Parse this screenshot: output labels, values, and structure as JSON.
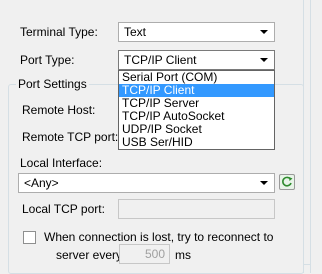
{
  "form": {
    "terminal_type_label": "Terminal Type:",
    "terminal_type_value": "Text",
    "port_type_label": "Port Type:",
    "port_type_value": "TCP/IP Client"
  },
  "port_type_options": [
    {
      "label": "Serial Port (COM)",
      "selected": false
    },
    {
      "label": "TCP/IP Client",
      "selected": true
    },
    {
      "label": "TCP/IP Server",
      "selected": false
    },
    {
      "label": "TCP/IP AutoSocket",
      "selected": false
    },
    {
      "label": "UDP/IP Socket",
      "selected": false
    },
    {
      "label": "USB Ser/HID",
      "selected": false
    }
  ],
  "port_settings": {
    "title": "Port Settings",
    "remote_host_label": "Remote Host:",
    "remote_tcp_port_label": "Remote TCP port:",
    "local_interface_label": "Local Interface:",
    "local_interface_value": "<Any>",
    "local_tcp_port_label": "Local TCP port:",
    "reconnect_label_line1": "When connection is lost, try to reconnect to",
    "reconnect_label_line2_prefix": "server every",
    "reconnect_interval_value": "500",
    "reconnect_interval_unit": "ms"
  },
  "colors": {
    "selection": "#3399ff",
    "background": "#f0f0f0"
  },
  "icons": {
    "refresh": "refresh-icon"
  }
}
